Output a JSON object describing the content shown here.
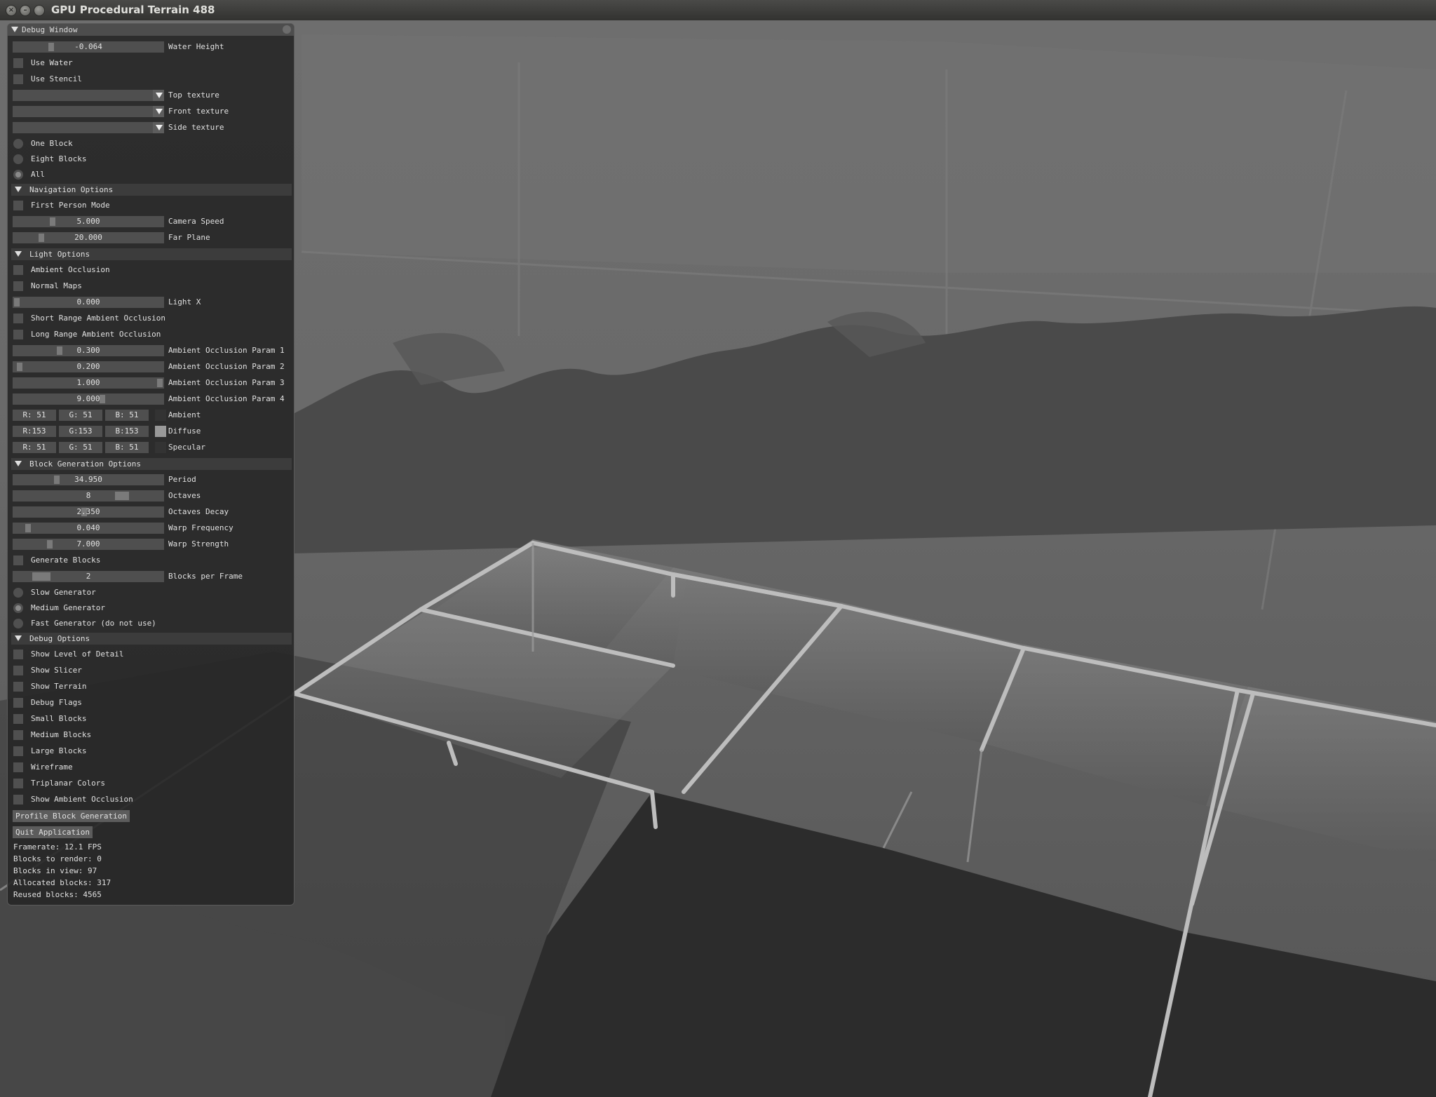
{
  "window": {
    "title": "GPU Procedural Terrain 488"
  },
  "debug_window": {
    "title": "Debug Window",
    "water_height": {
      "value": "-0.064",
      "label": "Water Height",
      "level": 0.24
    },
    "use_water": {
      "label": "Use Water",
      "checked": false
    },
    "use_stencil": {
      "label": "Use Stencil",
      "checked": false
    },
    "top_texture": {
      "value": "",
      "label": "Top texture"
    },
    "front_texture": {
      "value": "",
      "label": "Front texture"
    },
    "side_texture": {
      "value": "",
      "label": "Side texture"
    },
    "block_mode": {
      "options": [
        "One Block",
        "Eight Blocks",
        "All"
      ],
      "selected": "All"
    },
    "navigation": {
      "header": "Navigation Options",
      "first_person": {
        "label": "First Person Mode",
        "checked": false
      },
      "camera_speed": {
        "value": "5.000",
        "label": "Camera Speed",
        "level": 0.25
      },
      "far_plane": {
        "value": "20.000",
        "label": "Far Plane",
        "level": 0.17
      }
    },
    "light": {
      "header": "Light Options",
      "ambient_occlusion": {
        "label": "Ambient Occlusion",
        "checked": false
      },
      "normal_maps": {
        "label": "Normal Maps",
        "checked": false
      },
      "light_x": {
        "value": "0.000",
        "label": "Light X",
        "level": 0.0
      },
      "short_range_ao": {
        "label": "Short Range Ambient Occlusion",
        "checked": false
      },
      "long_range_ao": {
        "label": "Long Range Ambient Occlusion",
        "checked": false
      },
      "ao_param1": {
        "value": "0.300",
        "label": "Ambient Occlusion Param 1",
        "level": 0.3
      },
      "ao_param2": {
        "value": "0.200",
        "label": "Ambient Occlusion Param 2",
        "level": 0.02
      },
      "ao_param3": {
        "value": "1.000",
        "label": "Ambient Occlusion Param 3",
        "level": 1.0
      },
      "ao_param4": {
        "value": "9.000",
        "label": "Ambient Occlusion Param 4",
        "level": 0.6
      },
      "ambient": {
        "label": "Ambient",
        "r": "R: 51",
        "g": "G: 51",
        "b": "B: 51",
        "color": "#333333"
      },
      "diffuse": {
        "label": "Diffuse",
        "r": "R:153",
        "g": "G:153",
        "b": "B:153",
        "color": "#999999"
      },
      "specular": {
        "label": "Specular",
        "r": "R: 51",
        "g": "G: 51",
        "b": "B: 51",
        "color": "#333333"
      }
    },
    "block_generation": {
      "header": "Block Generation Options",
      "period": {
        "value": "34.950",
        "label": "Period",
        "level": 0.28
      },
      "octaves": {
        "value": "8",
        "label": "Octaves",
        "level": 0.75
      },
      "octaves_decay": {
        "value": "2.350",
        "label": "Octaves Decay",
        "level": 0.47
      },
      "warp_frequency": {
        "value": "0.040",
        "label": "Warp Frequency",
        "level": 0.08
      },
      "warp_strength": {
        "value": "7.000",
        "label": "Warp Strength",
        "level": 0.23
      },
      "generate_blocks": {
        "label": "Generate Blocks",
        "checked": false
      },
      "blocks_per_frame": {
        "value": "2",
        "label": "Blocks per Frame",
        "level": 0.14
      },
      "generator": {
        "options": [
          "Slow Generator",
          "Medium Generator",
          "Fast Generator (do not use)"
        ],
        "selected": "Medium Generator"
      }
    },
    "debug": {
      "header": "Debug Options",
      "checkboxes": [
        {
          "label": "Show Level of Detail",
          "checked": false
        },
        {
          "label": "Show Slicer",
          "checked": false
        },
        {
          "label": "Show Terrain",
          "checked": false
        },
        {
          "label": "Debug Flags",
          "checked": false
        },
        {
          "label": "Small Blocks",
          "checked": false
        },
        {
          "label": "Medium Blocks",
          "checked": false
        },
        {
          "label": "Large Blocks",
          "checked": false
        },
        {
          "label": "Wireframe",
          "checked": false
        },
        {
          "label": "Triplanar Colors",
          "checked": false
        },
        {
          "label": "Show Ambient Occlusion",
          "checked": false
        }
      ],
      "profile_button": "Profile Block Generation",
      "quit_button": "Quit Application"
    },
    "stats": [
      "Framerate: 12.1 FPS",
      "Blocks to render: 0",
      "Blocks in view: 97",
      "Allocated blocks: 317",
      "Reused blocks: 4565"
    ]
  },
  "colors": {
    "panel_bg": "#262626",
    "frame_bg": "#4f4f4f",
    "header_bg": "#3c3c3c",
    "text": "#e0e0e0"
  }
}
